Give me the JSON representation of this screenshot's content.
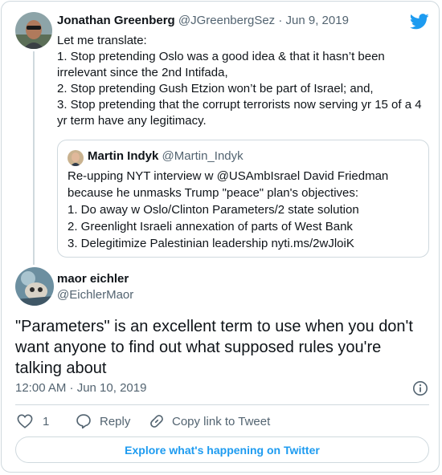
{
  "parent_tweet": {
    "author_name": "Jonathan Greenberg",
    "author_handle": "@JGreenbergSez",
    "separator": "·",
    "date": "Jun 9, 2019",
    "text_lines": [
      "Let me translate:",
      "1. Stop pretending Oslo was a good idea & that it hasn’t been",
      "irrelevant since the 2nd Intifada,",
      "2. Stop pretending Gush Etzion won’t be part of Israel; and,",
      "3. Stop pretending that the corrupt terrorists now serving yr 15 of a 4",
      "yr term have any legitimacy."
    ]
  },
  "quoted_tweet": {
    "author_name": "Martin Indyk",
    "author_handle": "@Martin_Indyk",
    "text_lines": [
      "Re-upping NYT interview w @USAmbIsrael David Friedman",
      "because he unmasks Trump \"peace\" plan's objectives:",
      "1. Do away w Oslo/Clinton Parameters/2 state solution",
      "2. Greenlight Israeli annexation of parts of West Bank",
      "3. Delegitimize Palestinian leadership nyti.ms/2wJloiK"
    ]
  },
  "reply_tweet": {
    "author_name": "maor eichler",
    "author_handle": "@EichlerMaor",
    "text_lines": [
      "\"Parameters\" is an excellent term to use when you don't",
      "want anyone to find out what supposed rules you're",
      "talking about"
    ],
    "timestamp": "12:00 AM · Jun 10, 2019"
  },
  "actions": {
    "like_count": "1",
    "reply_label": "Reply",
    "copy_link_label": "Copy link to Tweet"
  },
  "explore_button_label": "Explore what's happening on Twitter",
  "icons": {
    "brand": "twitter-bird-icon",
    "info": "info-icon",
    "like": "heart-icon",
    "reply": "speech-bubble-icon",
    "copy": "link-icon"
  },
  "colors": {
    "brand_blue": "#1d9bf0",
    "text": "#0f1419",
    "muted": "#536471",
    "border": "#cfd9de"
  }
}
